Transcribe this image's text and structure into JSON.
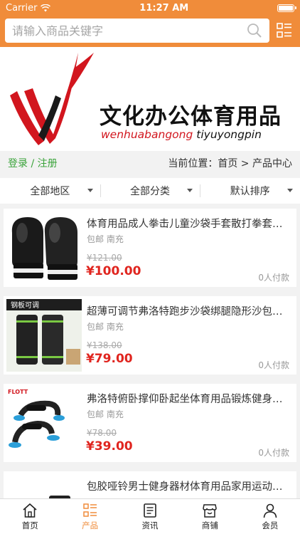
{
  "status": {
    "carrier": "Carrier",
    "time": "11:27 AM"
  },
  "search": {
    "placeholder": "请输入商品关键字"
  },
  "brand": {
    "name_cn": "文化办公体育用品",
    "pinyin_a": "wenhuabangong",
    "pinyin_b": "tiyuyongpin"
  },
  "crumb": {
    "login": "登录",
    "sep": " / ",
    "register": "注册",
    "position": "当前位置：首页 > 产品中心"
  },
  "filters": [
    "全部地区",
    "全部分类",
    "默认排序"
  ],
  "products": [
    {
      "title": "体育用品成人拳击儿童沙袋手套散打拳套…",
      "location": "包邮 南充",
      "old_price": "¥121.00",
      "price": "¥100.00",
      "paid": "0人付款",
      "thumb": "boxing-gloves-image"
    },
    {
      "title": "超薄可调节弗洛特跑步沙袋绑腿隐形沙包…",
      "location": "包邮 南充",
      "old_price": "¥138.00",
      "price": "¥79.00",
      "paid": "0人付款",
      "thumb": "leg-weights-image",
      "thumb_label": "钢板可调"
    },
    {
      "title": "弗洛特俯卧撑仰卧起坐体育用品锻炼健身…",
      "location": "包邮 南充",
      "old_price": "¥78.00",
      "price": "¥39.00",
      "paid": "0人付款",
      "thumb": "pushup-bars-image",
      "thumb_label": "FLOTT"
    },
    {
      "title": "包胶哑铃男士健身器材体育用品家用运动…",
      "location": "",
      "old_price": "",
      "price": "",
      "paid": "",
      "thumb": "dumbbell-image"
    }
  ],
  "tabs": [
    {
      "label": "首页",
      "icon": "home-icon"
    },
    {
      "label": "产品",
      "icon": "product-list-icon"
    },
    {
      "label": "资讯",
      "icon": "news-icon"
    },
    {
      "label": "商铺",
      "icon": "store-icon"
    },
    {
      "label": "会员",
      "icon": "member-icon"
    }
  ],
  "colors": {
    "accent": "#f08c3a",
    "price": "#e0251f",
    "login": "#3aa33a",
    "logo_red": "#d2161e"
  }
}
